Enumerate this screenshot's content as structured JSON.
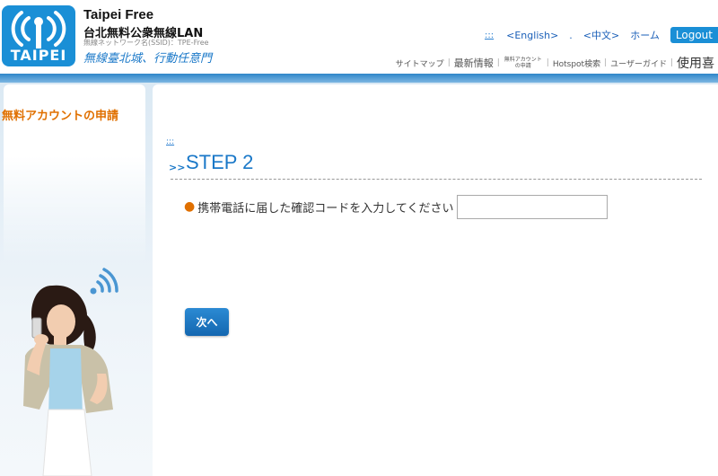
{
  "brand": {
    "logo_text": "TAIPEI",
    "title": "Taipei Free",
    "subtitle": "台北無料公衆無線LAN",
    "ssid": "無線ネットワーク名(SSID)：TPE-Free",
    "slogan": "無線臺北城、行動任意門"
  },
  "lang_bar": {
    "dots": ":::",
    "english": "<English>",
    "dot": ".",
    "chinese": "<中文>",
    "home": "ホーム",
    "logout": "Logout"
  },
  "menu": {
    "sitemap": "サイトマップ",
    "news": "最新情報",
    "free_account": "無料アカウント の申請",
    "hotspot": "Hotspot検索",
    "user_guide": "ユーザーガイド",
    "faq": "使用喜"
  },
  "sidebar": {
    "title": "無料アカウントの申請"
  },
  "main": {
    "breadcrumb": ":::",
    "step_arrows": ">>",
    "step_title": "STEP 2",
    "field_label": "携帯電話に届した確認コードを入力してください",
    "field_value": "",
    "next_label": "次へ"
  },
  "colors": {
    "accent": "#1a78c8",
    "orange": "#e07000",
    "button": "#1a6fb8"
  }
}
